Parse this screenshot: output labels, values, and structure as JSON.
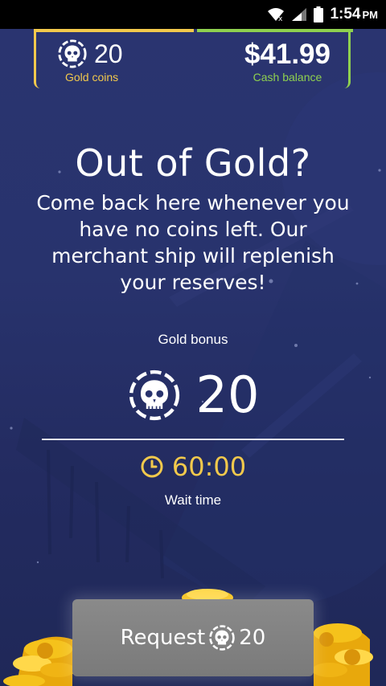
{
  "status_bar": {
    "time": "1:54",
    "ampm": "PM",
    "icons": [
      "wifi-icon",
      "signal-icon",
      "battery-icon"
    ]
  },
  "balances": {
    "gold_coins_value": "20",
    "gold_coins_label": "Gold coins",
    "cash_value": "$41.99",
    "cash_label": "Cash balance"
  },
  "content": {
    "headline": "Out of Gold?",
    "description": "Come back here whenever you have no coins left. Our merchant ship will replenish your reserves!",
    "bonus_label": "Gold bonus",
    "bonus_value": "20",
    "wait_value": "60:00",
    "wait_label": "Wait time"
  },
  "button": {
    "label": "Request",
    "amount": "20"
  },
  "colors": {
    "background": "#28336d",
    "gold_accent": "#f2c94c",
    "cash_accent": "#8fd14f",
    "button_bg": "#808080"
  },
  "icons": {
    "coin": "skull-coin-icon",
    "timer": "clock-icon"
  }
}
